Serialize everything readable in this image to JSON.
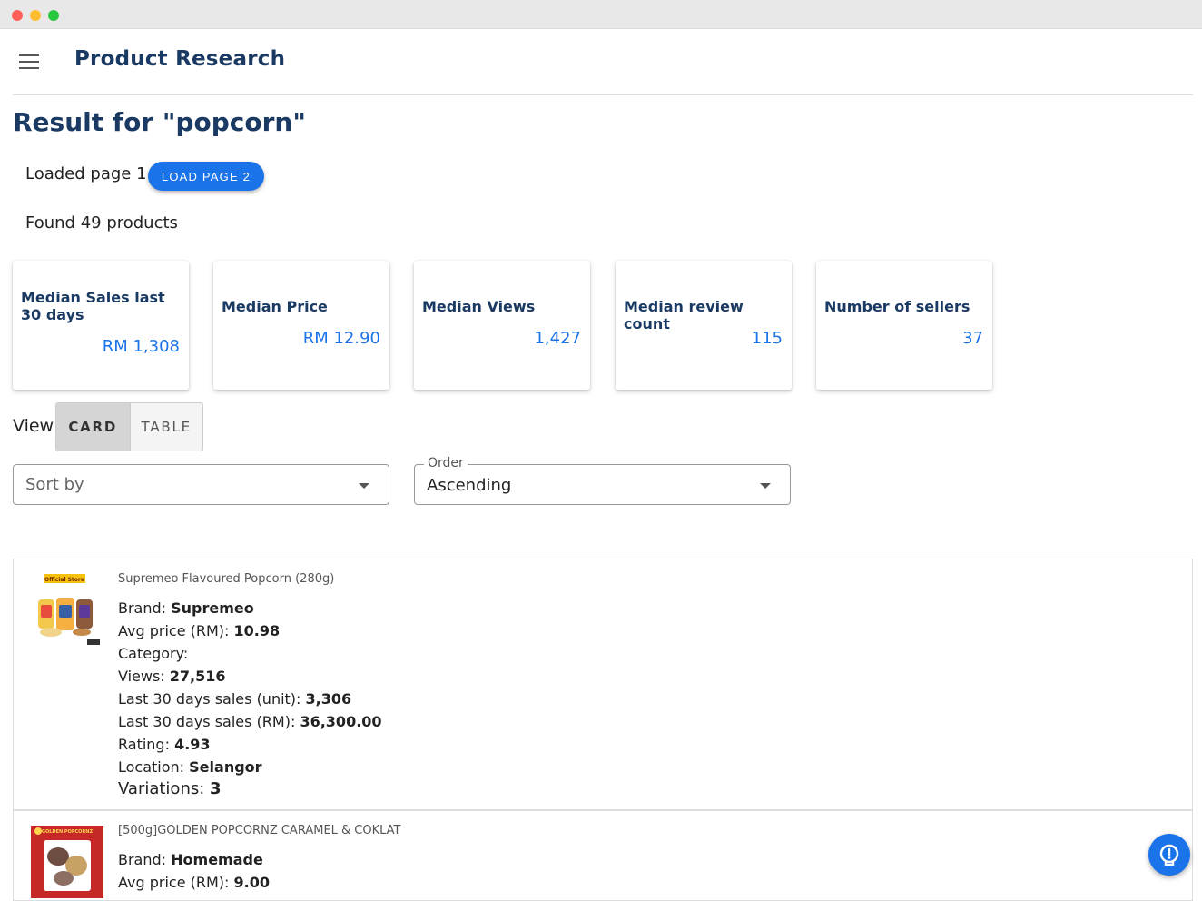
{
  "app": {
    "title": "Product Research"
  },
  "header": {
    "result_title": "Result for \"popcorn\""
  },
  "paging": {
    "loaded_text": "Loaded page 1",
    "load_button": "LOAD PAGE 2"
  },
  "found_text": "Found 49 products",
  "stats": [
    {
      "label": "Median Sales last 30 days",
      "value": "RM 1,308"
    },
    {
      "label": "Median Price",
      "value": "RM 12.90"
    },
    {
      "label": "Median Views",
      "value": "1,427"
    },
    {
      "label": "Median review count",
      "value": "115"
    },
    {
      "label": "Number of sellers",
      "value": "37"
    }
  ],
  "view": {
    "label": "View",
    "card": "CARD",
    "table": "TABLE",
    "selected": "CARD"
  },
  "sort": {
    "placeholder": "Sort by"
  },
  "order": {
    "legend": "Order",
    "value": "Ascending"
  },
  "products": [
    {
      "name": "Supremeo Flavoured Popcorn (280g)",
      "badge": "Official Store",
      "brand_label": "Brand: ",
      "brand": "Supremeo",
      "price_label": "Avg price (RM): ",
      "price": "10.98",
      "category_label": "Category:",
      "views_label": "Views: ",
      "views": "27,516",
      "units_label": "Last 30 days sales (unit): ",
      "units": "3,306",
      "rm_label": "Last 30 days sales (RM): ",
      "rm": "36,300.00",
      "rating_label": "Rating: ",
      "rating": "4.93",
      "location_label": "Location: ",
      "location": "Selangor",
      "variations_label": "Variations: ",
      "variations": "3"
    },
    {
      "name": "[500g]GOLDEN POPCORNZ CARAMEL & COKLAT",
      "badge": "GOLDEN POPCORNZ",
      "brand_label": "Brand: ",
      "brand": "Homemade",
      "price_label": "Avg price (RM): ",
      "price": "9.00"
    }
  ],
  "colors": {
    "primary": "#1a73e8",
    "heading": "#1a3a63"
  },
  "icons": {
    "menu": "hamburger-menu-icon",
    "help": "lightbulb-help-icon",
    "dropdown": "arrow-drop-down-icon"
  }
}
